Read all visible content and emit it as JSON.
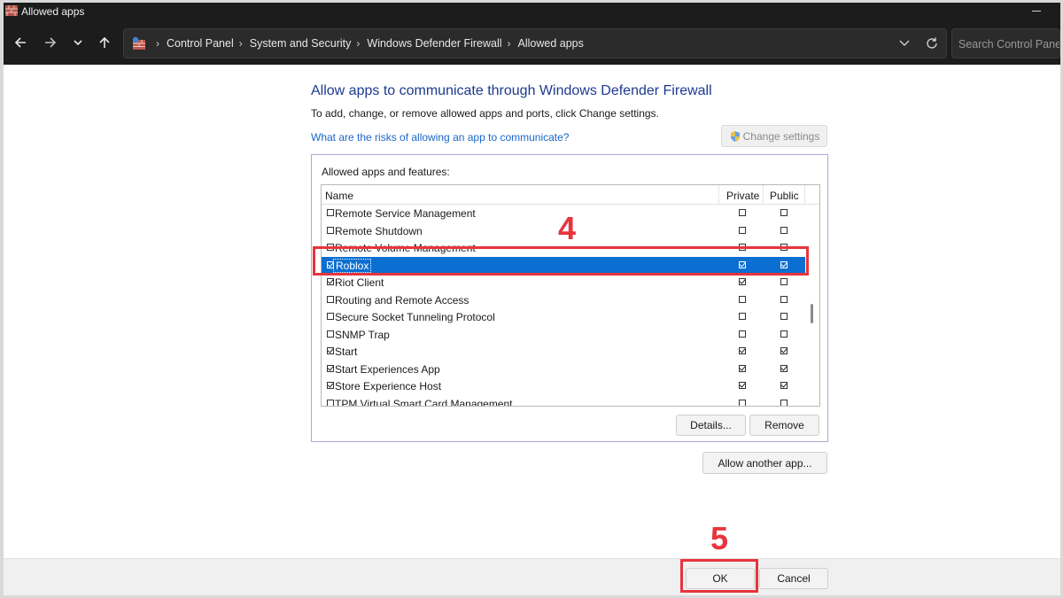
{
  "window": {
    "title": "Allowed apps"
  },
  "addressbar": {
    "breadcrumbs": [
      "Control Panel",
      "System and Security",
      "Windows Defender Firewall",
      "Allowed apps"
    ]
  },
  "search": {
    "placeholder": "Search Control Panel"
  },
  "main": {
    "heading": "Allow apps to communicate through Windows Defender Firewall",
    "description": "To add, change, or remove allowed apps and ports, click Change settings.",
    "risk_link": "What are the risks of allowing an app to communicate?",
    "change_settings_label": "Change settings"
  },
  "apps_group": {
    "label": "Allowed apps and features:",
    "columns": {
      "name": "Name",
      "private": "Private",
      "public": "Public"
    },
    "rows": [
      {
        "name": "Remote Service Management",
        "enabled": false,
        "private": false,
        "public": false
      },
      {
        "name": "Remote Shutdown",
        "enabled": false,
        "private": false,
        "public": false
      },
      {
        "name": "Remote Volume Management",
        "enabled": false,
        "private": false,
        "public": false
      },
      {
        "name": "Roblox",
        "enabled": true,
        "private": true,
        "public": true,
        "selected": true
      },
      {
        "name": "Riot Client",
        "enabled": true,
        "private": true,
        "public": false
      },
      {
        "name": "Routing and Remote Access",
        "enabled": false,
        "private": false,
        "public": false
      },
      {
        "name": "Secure Socket Tunneling Protocol",
        "enabled": false,
        "private": false,
        "public": false
      },
      {
        "name": "SNMP Trap",
        "enabled": false,
        "private": false,
        "public": false
      },
      {
        "name": "Start",
        "enabled": true,
        "private": true,
        "public": true
      },
      {
        "name": "Start Experiences App",
        "enabled": true,
        "private": true,
        "public": true
      },
      {
        "name": "Store Experience Host",
        "enabled": true,
        "private": true,
        "public": true
      },
      {
        "name": "TPM Virtual Smart Card Management",
        "enabled": false,
        "private": false,
        "public": false
      }
    ],
    "details_label": "Details...",
    "remove_label": "Remove"
  },
  "allow_another_label": "Allow another app...",
  "footer": {
    "ok_label": "OK",
    "cancel_label": "Cancel"
  },
  "annotations": {
    "step_select": "4",
    "step_ok": "5",
    "color": "#e8343c"
  },
  "colors": {
    "selection": "#0a6fd1",
    "heading": "#1c3a8f",
    "link": "#1a66c9",
    "titlebar": "#1c1c1c"
  },
  "icons": {
    "back": "arrow-left-icon",
    "forward": "arrow-right-icon",
    "recent": "chevron-down-icon",
    "up": "arrow-up-icon",
    "refresh": "refresh-icon",
    "address_dropdown": "chevron-down-icon",
    "uac": "shield-icon",
    "app": "firewall-icon"
  }
}
